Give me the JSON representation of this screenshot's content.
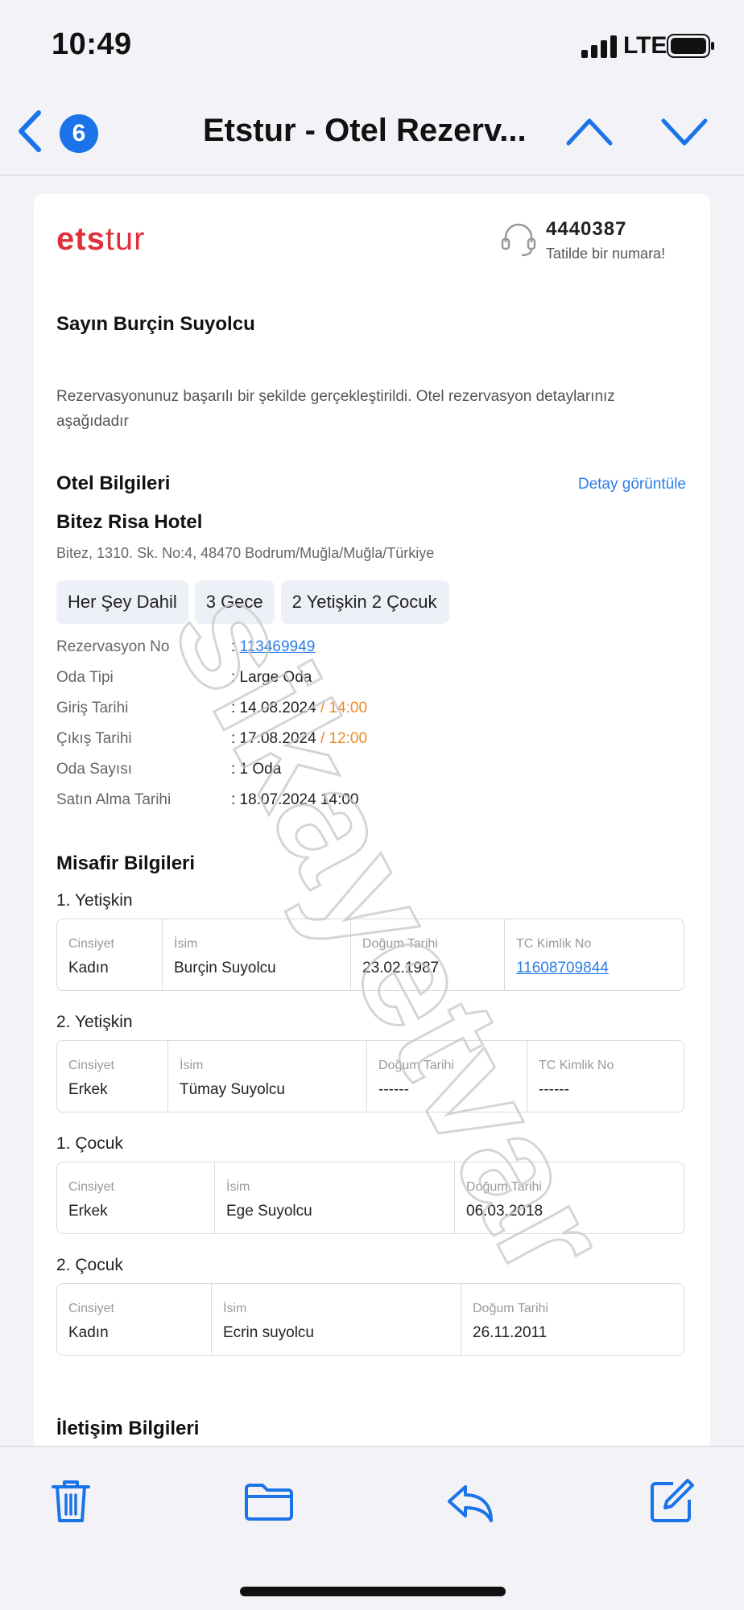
{
  "status_bar": {
    "time": "10:49",
    "network": "LTE",
    "icons": [
      "signal-icon",
      "battery-icon"
    ]
  },
  "nav": {
    "unread_count": "6",
    "title": "Etstur - Otel Rezerv...",
    "icons": [
      "back-chevron-icon",
      "up-chevron-icon",
      "down-chevron-icon"
    ]
  },
  "email": {
    "brand": {
      "logo_bold": "ets",
      "logo_light": "tur",
      "phone": "4440387",
      "tagline": "Tatilde bir numara!"
    },
    "greeting": "Sayın Burçin Suyolcu",
    "intro": "Rezervasyonunuz başarılı bir şekilde gerçekleştirildi. Otel rezervasyon detaylarınız aşağıdadır",
    "hotel_section": {
      "title": "Otel Bilgileri",
      "detail_link": "Detay görüntüle",
      "hotel_name": "Bitez Risa Hotel",
      "address": "Bitez, 1310. Sk. No:4, 48470 Bodrum/Muğla/Muğla/Türkiye",
      "chips": [
        "Her Şey Dahil",
        "3 Gece",
        "2 Yetişkin 2 Çocuk"
      ],
      "details": {
        "reservation_no": {
          "label": "Rezervasyon No",
          "value": "113469949"
        },
        "room_type": {
          "label": "Oda Tipi",
          "value": ": Large Oda"
        },
        "check_in": {
          "label": "Giriş Tarihi",
          "date": ": 14.08.2024",
          "time": "/ 14:00"
        },
        "check_out": {
          "label": "Çıkış Tarihi",
          "date": ": 17.08.2024 ",
          "time": "/ 12:00"
        },
        "room_count": {
          "label": "Oda Sayısı",
          "value": ": 1  Oda"
        },
        "purchase_date": {
          "label": "Satın Alma Tarihi",
          "value": ": 18.07.2024 14:00"
        }
      }
    },
    "guest_section": {
      "title": "Misafir Bilgileri",
      "headers": {
        "gender": "Cinsiyet",
        "name": "İsim",
        "birth": "Doğum Tarihi",
        "tc": "TC Kimlik No"
      },
      "guests": [
        {
          "label": "1. Yetişkin",
          "gender": "Kadın",
          "name": "Burçin Suyolcu",
          "birth": "23.02.1987",
          "tc": "11608709844"
        },
        {
          "label": "2. Yetişkin",
          "gender": "Erkek",
          "name": "Tümay Suyolcu",
          "birth": "------",
          "tc": "------"
        },
        {
          "label": "1. Çocuk",
          "gender": "Erkek",
          "name": "Ege Suyolcu",
          "birth": "06.03.2018"
        },
        {
          "label": "2. Çocuk",
          "gender": "Kadın",
          "name": "Ecrin suyolcu",
          "birth": "26.11.2011"
        }
      ]
    },
    "contact_section": {
      "title": "İletişim Bilgileri"
    }
  },
  "watermark": {
    "text": "sikayetvar"
  },
  "toolbar": {
    "icons": [
      "trash-icon",
      "folder-icon",
      "reply-icon",
      "compose-icon"
    ]
  },
  "colors": {
    "accent": "#2b7de9",
    "brand": "#e0303c",
    "time_highlight": "#f08a24",
    "badge": "#1a73e8"
  }
}
